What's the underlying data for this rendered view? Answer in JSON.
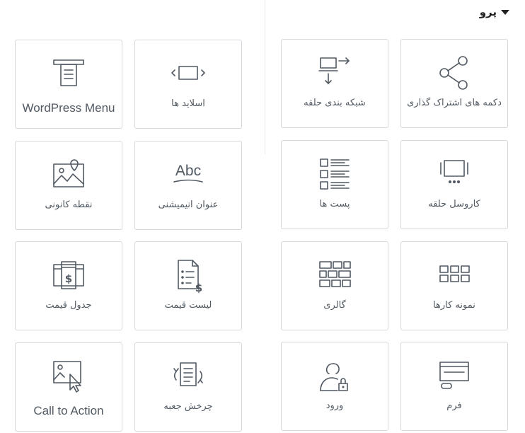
{
  "section": {
    "title": "پرو"
  },
  "widgets": [
    {
      "label": "دکمه های اشتراک گذاری",
      "icon": "share-icon"
    },
    {
      "label": "شبکه بندی حلقه",
      "icon": "loop-grid-icon"
    },
    {
      "label": "اسلاید ها",
      "icon": "slides-icon"
    },
    {
      "label": "WordPress Menu",
      "icon": "wordpress-menu-icon"
    },
    {
      "label": "کاروسل حلقه",
      "icon": "loop-carousel-icon"
    },
    {
      "label": "پست ها",
      "icon": "posts-icon"
    },
    {
      "label": "عنوان انیمیشنی",
      "icon": "animated-headline-icon"
    },
    {
      "label": "نقطه کانونی",
      "icon": "hotspot-icon"
    },
    {
      "label": "نمونه کارها",
      "icon": "portfolio-icon"
    },
    {
      "label": "گالری",
      "icon": "gallery-icon"
    },
    {
      "label": "لیست قیمت",
      "icon": "price-list-icon"
    },
    {
      "label": "جدول قیمت",
      "icon": "price-table-icon"
    },
    {
      "label": "فرم",
      "icon": "form-icon"
    },
    {
      "label": "ورود",
      "icon": "login-icon"
    },
    {
      "label": "چرخش جعبه",
      "icon": "flip-box-icon"
    },
    {
      "label": "Call to Action",
      "icon": "call-to-action-icon"
    }
  ],
  "icon_text": {
    "abc": "Abc",
    "dollar": "$"
  },
  "colors": {
    "icon": "#515962",
    "border": "#d5d8dc",
    "header": "#222222"
  }
}
